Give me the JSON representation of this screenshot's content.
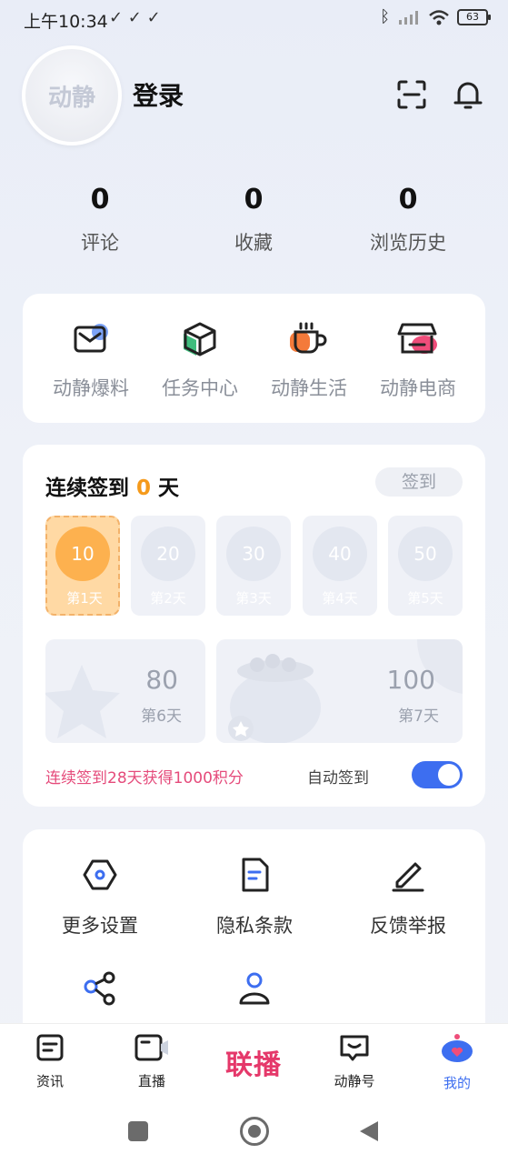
{
  "status_bar": {
    "time": "上午10:34",
    "battery": "63"
  },
  "header": {
    "avatar_text": "动静",
    "login_label": "登录",
    "scan_icon": "scan-icon",
    "bell_icon": "bell-icon"
  },
  "stats": [
    {
      "value": "0",
      "label": "评论"
    },
    {
      "value": "0",
      "label": "收藏"
    },
    {
      "value": "0",
      "label": "浏览历史"
    }
  ],
  "quick_links": [
    {
      "label": "动静爆料",
      "icon": "mail-icon",
      "color": "#5b8cf5"
    },
    {
      "label": "任务中心",
      "icon": "box-icon",
      "color": "#3fbd7d"
    },
    {
      "label": "动静生活",
      "icon": "cup-icon",
      "color": "#f47a3a"
    },
    {
      "label": "动静电商",
      "icon": "store-icon",
      "color": "#ef4d7a"
    }
  ],
  "signin": {
    "title_prefix": "连续签到",
    "streak": "0",
    "title_suffix": "天",
    "button": "签到",
    "days": [
      {
        "points": "10",
        "day": "第1天"
      },
      {
        "points": "20",
        "day": "第2天"
      },
      {
        "points": "30",
        "day": "第3天"
      },
      {
        "points": "40",
        "day": "第4天"
      },
      {
        "points": "50",
        "day": "第5天"
      },
      {
        "points": "80",
        "day": "第6天"
      },
      {
        "points": "100",
        "day": "第7天"
      }
    ],
    "promo": "连续签到28天获得1000积分",
    "auto_label": "自动签到",
    "auto_on": true
  },
  "settings": [
    {
      "label": "更多设置",
      "icon": "hexagon-settings-icon"
    },
    {
      "label": "隐私条款",
      "icon": "document-icon"
    },
    {
      "label": "反馈举报",
      "icon": "pen-icon"
    },
    {
      "label": "",
      "icon": "share-icon"
    },
    {
      "label": "",
      "icon": "user-icon"
    }
  ],
  "tabbar": [
    {
      "label": "资讯",
      "icon": "news-icon"
    },
    {
      "label": "直播",
      "icon": "live-icon"
    },
    {
      "label": "联播",
      "icon": "lianbo-logo"
    },
    {
      "label": "动静号",
      "icon": "dongjing-hao-icon"
    },
    {
      "label": "我的",
      "icon": "mine-icon",
      "active": true
    }
  ],
  "colors": {
    "accent": "#3d6ef0",
    "streak": "#f59a1b",
    "promo": "#e54b7b"
  }
}
